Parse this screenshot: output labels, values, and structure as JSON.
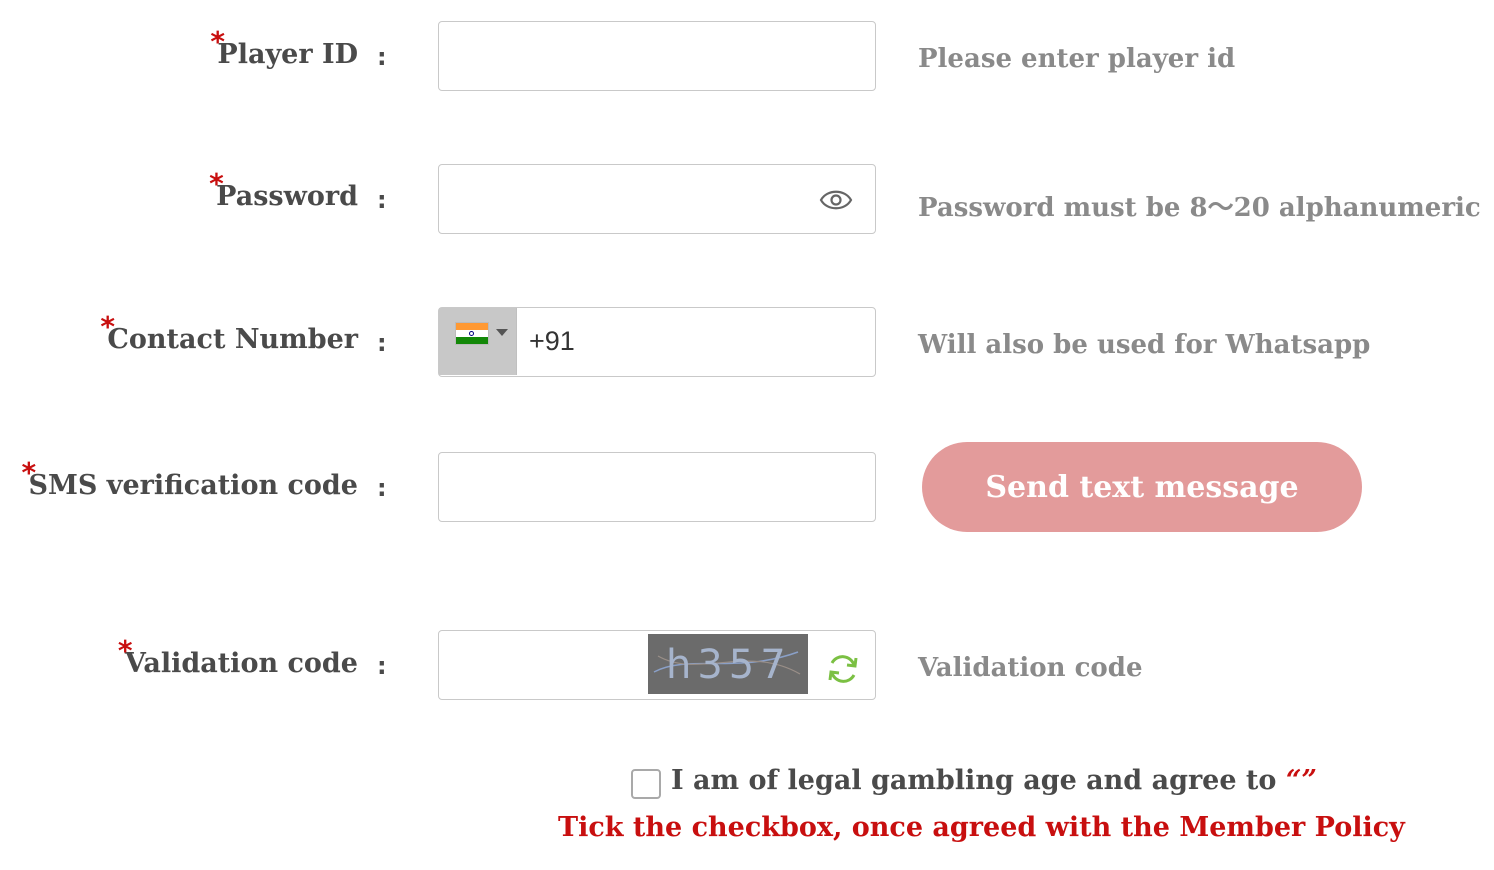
{
  "fields": {
    "player_id": {
      "label": "Player ID",
      "colon": ":",
      "value": "",
      "hint": "Please enter player id"
    },
    "password": {
      "label": "Password",
      "colon": ":",
      "value": "",
      "hint": "Password must be 8～20 alphanumeric",
      "icon": "eye-icon"
    },
    "contact": {
      "label": "Contact Number",
      "colon": ":",
      "country_flag": "india-flag",
      "dial_code": "+91",
      "hint": "Will also be used for Whatsapp"
    },
    "sms": {
      "label": "SMS verification code",
      "colon": ":",
      "value": "",
      "button_label": "Send text message"
    },
    "validation": {
      "label": "Validation code",
      "colon": ":",
      "value": "",
      "captcha_text": "h357",
      "hint": "Validation code",
      "icon": "refresh-icon"
    }
  },
  "required_marker": "*",
  "agreement": {
    "checked": false,
    "text": "I am of legal gambling age and agree to",
    "quotes": "“”",
    "policy_note": "Tick the checkbox, once agreed with the Member Policy"
  },
  "colors": {
    "required": "#c80f0f",
    "label": "#4a4a4a",
    "hint": "#8a8a8a",
    "button_bg": "#e39b9b",
    "policy_note": "#c80f0f"
  }
}
